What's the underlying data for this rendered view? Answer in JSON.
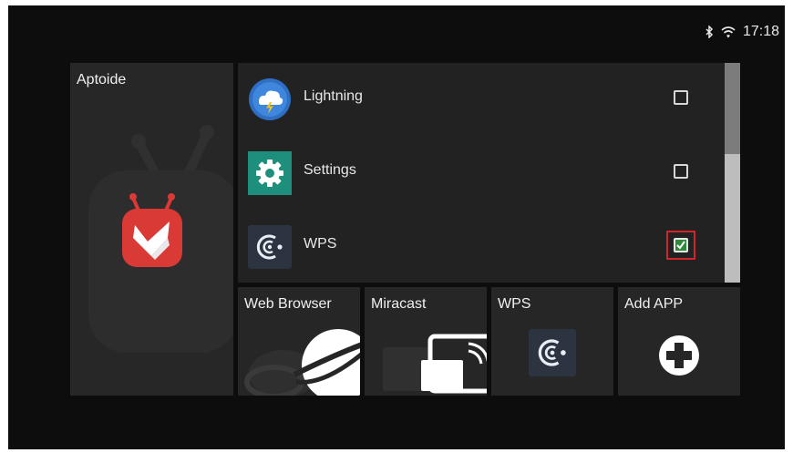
{
  "status_bar": {
    "bluetooth_icon": "bluetooth-icon",
    "wifi_icon": "wifi-icon",
    "time": "17:18"
  },
  "aptoide_tile": {
    "title": "Aptoide",
    "icon": "aptoide-icon"
  },
  "app_list": {
    "items": [
      {
        "label": "Lightning",
        "icon": "lightning-weather-icon",
        "checked": false
      },
      {
        "label": "Settings",
        "icon": "gear-icon",
        "checked": false
      },
      {
        "label": "WPS",
        "icon": "wps-icon",
        "checked": true
      }
    ]
  },
  "bottom_tiles": {
    "web_browser": "Web Browser",
    "miracast": "Miracast",
    "wps": "WPS",
    "add_app": "Add APP"
  },
  "colors": {
    "background": "#0d0d0d",
    "tile": "#262626",
    "aptoide_red": "#d93a36",
    "settings_teal": "#1f8f7d",
    "lightning_blue": "#2e6fc4",
    "focus_red": "#d0252b",
    "check_green": "#2f8a3c"
  }
}
